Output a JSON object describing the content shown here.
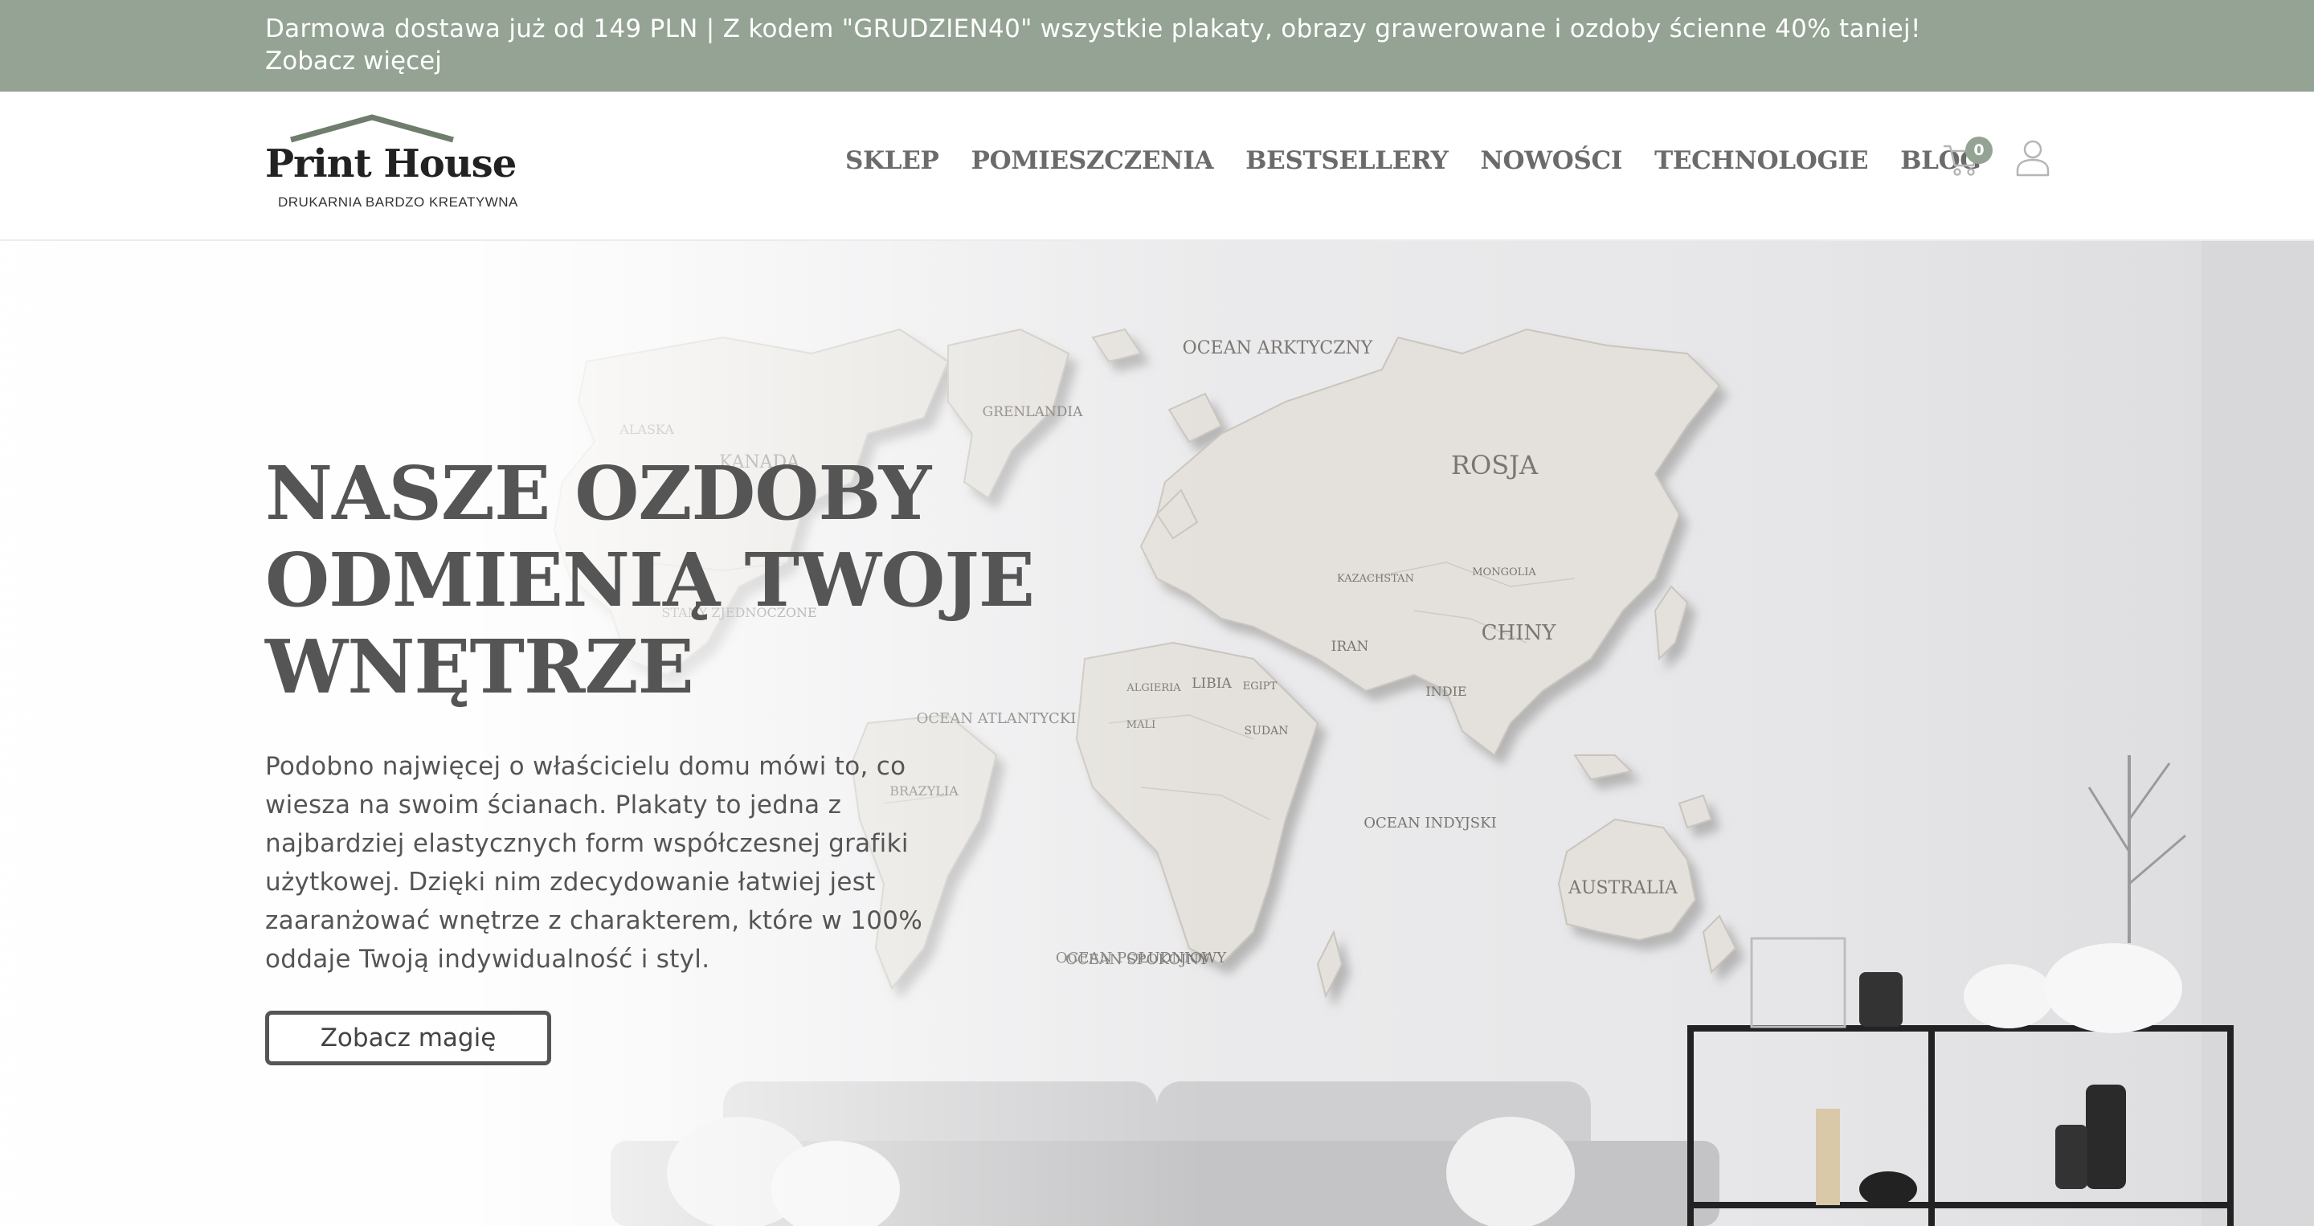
{
  "promo": {
    "text": "Darmowa dostawa już od 149 PLN | Z kodem \"GRUDZIEN40\" wszystkie plakaty, obrazy grawerowane i ozdoby ścienne 40% taniej!",
    "link": "Zobacz więcej"
  },
  "header": {
    "logo_name": "Print House",
    "logo_tagline": "DRUKARNIA BARDZO KREATYWNA",
    "nav": [
      "SKLEP",
      "POMIESZCZENIA",
      "BESTSELLERY",
      "NOWOŚCI",
      "TECHNOLOGIE",
      "BLOG"
    ],
    "cart_count": "0",
    "icons": {
      "cart": "cart-icon",
      "user": "user-icon"
    }
  },
  "hero": {
    "title_lines": [
      "NASZE OZDOBY",
      "ODMIENIĄ TWOJE",
      "WNĘTRZE"
    ],
    "description": "Podobno najwięcej o właścicielu domu mówi to, co wiesza na swoim ścianach. Plakaty to jedna z najbardziej elastycznych form współczesnej grafiki użytkowej. Dzięki nim zdecydowanie łatwiej jest zaaranżować wnętrze z charakterem, które w 100% oddaje Twoją indywidualność i styl.",
    "button": "Zobacz magię",
    "map_labels": {
      "arctic": "OCEAN ARKTYCZNY",
      "greenland": "GRENLANDIA",
      "alaska": "ALASKA",
      "canada": "KANADA",
      "usa": "STANY ZJEDNOCZONE",
      "atlantic": "OCEAN ATLANTYCKI",
      "pacific": "OCEAN SPOKOJNY",
      "brazil": "BRAZYLIA",
      "russia": "ROSJA",
      "kazakhstan": "KAZACHSTAN",
      "mongolia": "MONGOLIA",
      "china": "CHINY",
      "iran": "IRAN",
      "india": "INDIE",
      "algeria": "ALGIERIA",
      "libya": "LIBIA",
      "egypt": "EGIPT",
      "mali": "MALI",
      "sudan": "SUDAN",
      "indian": "OCEAN INDYJSKI",
      "southern": "OCEAN POŁUDNIOWY",
      "australia": "AUSTRALIA"
    }
  },
  "colors": {
    "promo_bg": "#94a393",
    "text": "#555555",
    "accent": "#94a393"
  }
}
